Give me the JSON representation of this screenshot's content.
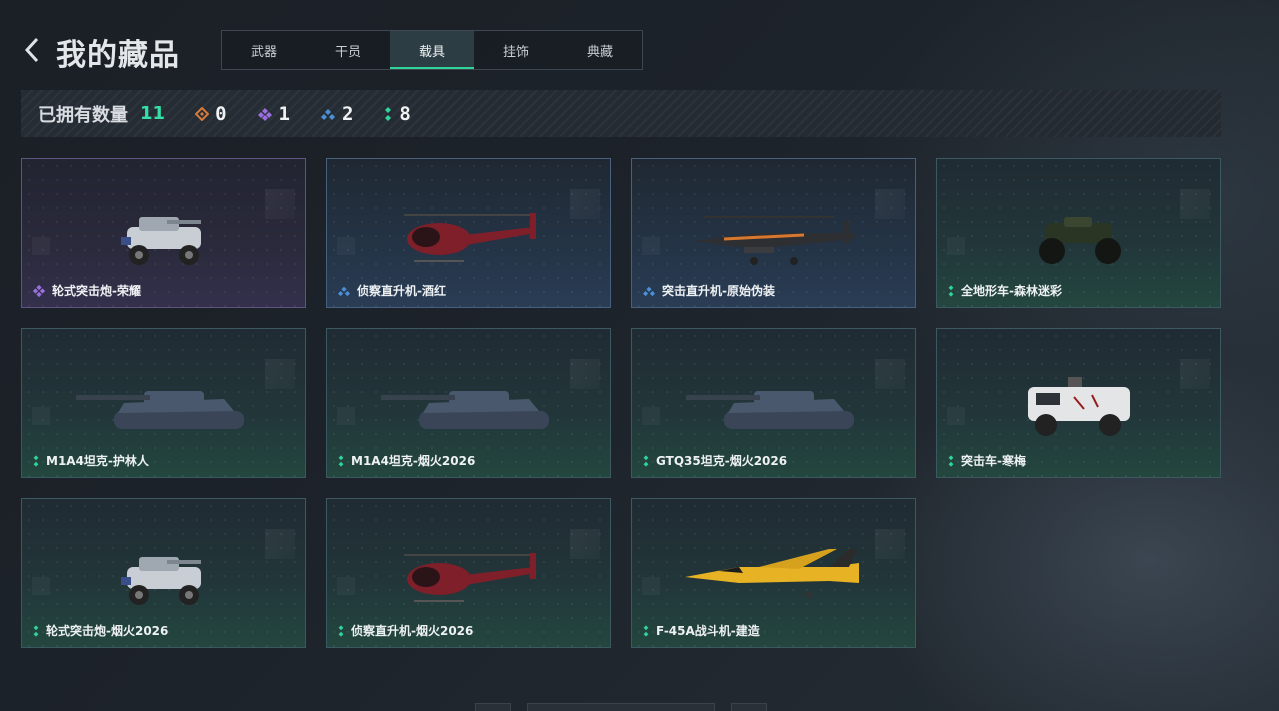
{
  "header": {
    "title": "我的藏品",
    "tabs": [
      "武器",
      "干员",
      "载具",
      "挂饰",
      "典藏"
    ],
    "active_tab": 2
  },
  "stats": {
    "label": "已拥有数量",
    "total": "11",
    "items": [
      {
        "icon": "orange-diamond-icon",
        "color": "#d77a3b",
        "count": "0"
      },
      {
        "icon": "purple-diamond-icon",
        "color": "#9a6fe0",
        "count": "1"
      },
      {
        "icon": "blue-diamond-icon",
        "color": "#4a90d9",
        "count": "2"
      },
      {
        "icon": "green-diamond-icon",
        "color": "#2fd49a",
        "count": "8"
      }
    ]
  },
  "vehicles": [
    {
      "name": "轮式突击炮-荣耀",
      "rarity": "purple",
      "type": "armored-car"
    },
    {
      "name": "侦察直升机-酒红",
      "rarity": "blue",
      "type": "scout-heli"
    },
    {
      "name": "突击直升机-原始伪装",
      "rarity": "blue",
      "type": "attack-heli"
    },
    {
      "name": "全地形车-森林迷彩",
      "rarity": "green",
      "type": "atv"
    },
    {
      "name": "M1A4坦克-护林人",
      "rarity": "green",
      "type": "tank"
    },
    {
      "name": "M1A4坦克-烟火2026",
      "rarity": "green",
      "type": "tank"
    },
    {
      "name": "GTQ35坦克-烟火2026",
      "rarity": "green",
      "type": "tank"
    },
    {
      "name": "突击车-寒梅",
      "rarity": "green",
      "type": "assault-truck"
    },
    {
      "name": "轮式突击炮-烟火2026",
      "rarity": "green",
      "type": "armored-car"
    },
    {
      "name": "侦察直升机-烟火2026",
      "rarity": "green",
      "type": "scout-heli"
    },
    {
      "name": "F-45A战斗机-建造",
      "rarity": "green",
      "type": "jet"
    }
  ],
  "colors": {
    "accent": "#2fd49a",
    "purple": "#9a6fe0",
    "blue": "#4a90d9",
    "orange": "#d77a3b"
  }
}
